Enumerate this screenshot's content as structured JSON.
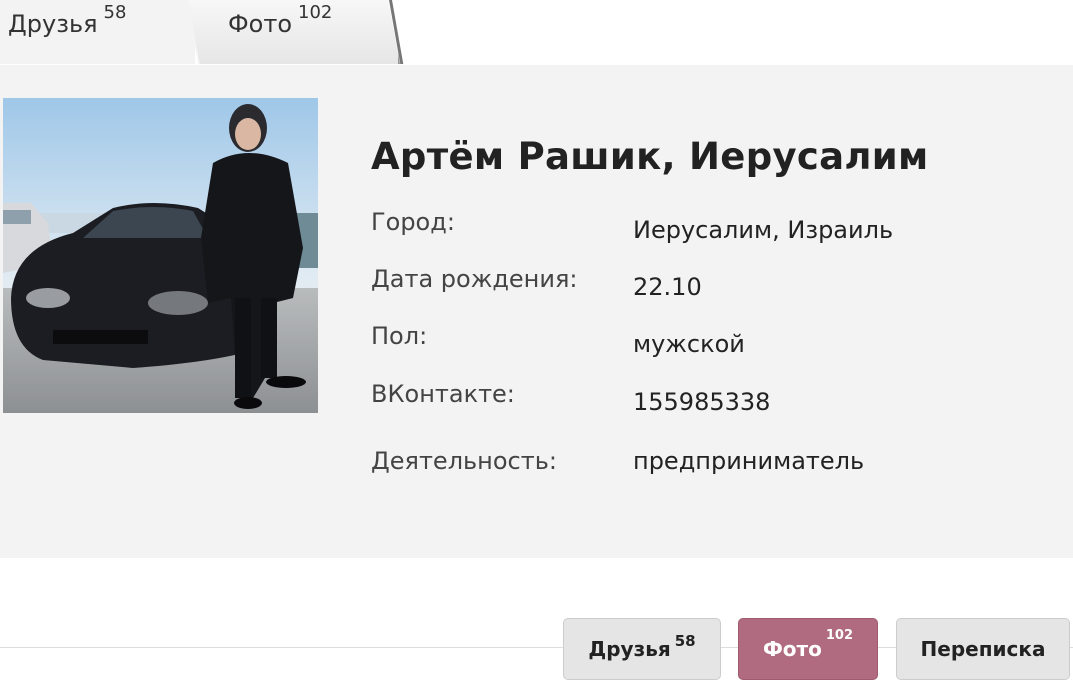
{
  "tabs": {
    "friends": {
      "label": "Друзья",
      "count": "58"
    },
    "photo": {
      "label": "Фото",
      "count": "102"
    }
  },
  "profile": {
    "name": "Артём Рашик, Иерусалим",
    "fields": [
      {
        "label": "Город:",
        "value": "Иерусалим, Израиль"
      },
      {
        "label": "Дата рождения:",
        "value": "22.10"
      },
      {
        "label": "Пол:",
        "value": "мужской"
      },
      {
        "label": "ВКонтакте:",
        "value": "155985338"
      },
      {
        "label": "Деятельность:",
        "value": "предприниматель"
      }
    ]
  },
  "actions": {
    "friends": {
      "label": "Друзья",
      "count": "58"
    },
    "photo": {
      "label": "Фото",
      "count": "102"
    },
    "messages": {
      "label": "Переписка"
    }
  },
  "colors": {
    "panel_bg": "#f3f3f3",
    "photo_button": "#b06b80",
    "neutral_button": "#e5e5e5"
  }
}
